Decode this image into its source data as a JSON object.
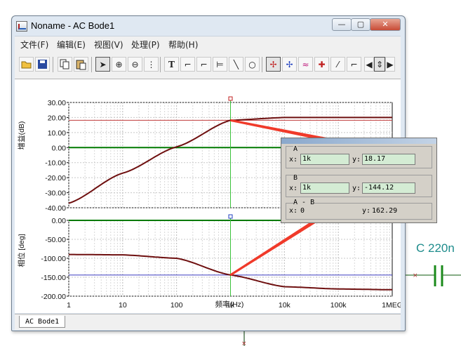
{
  "window": {
    "title": "Noname - AC Bode1",
    "controls": {
      "minimize": "—",
      "maximize": "▢",
      "close": "✕"
    }
  },
  "menu": [
    "文件(F)",
    "编辑(E)",
    "视图(V)",
    "处理(P)",
    "帮助(H)"
  ],
  "toolbar": [
    "open-folder-icon",
    "save-icon",
    "copy-icon",
    "paste-icon",
    "select-arrow-icon",
    "zoom-in-icon",
    "zoom-100-icon",
    "grid-icon",
    "text-tool-icon",
    "label-tool-icon",
    "label-tool-2-icon",
    "axis-tool-icon",
    "line-tool-icon",
    "ellipse-tool-icon",
    "cursor-a-icon",
    "cursor-b-icon",
    "trace-icon",
    "marker-icon",
    "angle-icon",
    "scroll-left-icon",
    "scroll-updown-icon",
    "scroll-right-icon"
  ],
  "gain_plot": {
    "ylabel": "增益(dB)",
    "yticks": [
      "30.00",
      "20.00",
      "10.00",
      "0.00",
      "-10.00",
      "-20.00",
      "-30.00",
      "-40.00"
    ]
  },
  "phase_plot": {
    "ylabel": "相位 [deg]",
    "yticks": [
      "0.00",
      "-50.00",
      "-100.00",
      "-150.00",
      "-200.00"
    ]
  },
  "x_axis": {
    "xlabel": "频率(Hz)",
    "xticks": [
      "1",
      "10",
      "100",
      "1k",
      "10k",
      "100k",
      "1MEG"
    ]
  },
  "chart_data": [
    {
      "type": "line",
      "ylabel": "增益(dB)",
      "x_scale": "log",
      "xlim": [
        1,
        1000000
      ],
      "ylim": [
        -40,
        30
      ],
      "grid": true,
      "x": [
        1,
        10,
        100,
        1000,
        10000,
        100000,
        1000000
      ],
      "values": [
        -37,
        -17,
        0.5,
        18.17,
        20,
        20,
        20
      ]
    },
    {
      "type": "line",
      "ylabel": "相位 [deg]",
      "x_scale": "log",
      "xlim": [
        1,
        1000000
      ],
      "ylim": [
        -200,
        0
      ],
      "grid": true,
      "x": [
        1,
        10,
        100,
        1000,
        10000,
        100000,
        1000000
      ],
      "values": [
        -90,
        -91,
        -100,
        -144.12,
        -175,
        -181,
        -183
      ]
    }
  ],
  "cursor_dialog": {
    "a_label": "A",
    "a_x": "1k",
    "a_y": "18.17",
    "b_label": "B",
    "b_x": "1k",
    "b_y": "-144.12",
    "diff_label": "A - B",
    "diff_x": "0",
    "diff_y": "162.29",
    "x_prefix": "x:",
    "y_prefix": "y:"
  },
  "status": {
    "tab": "AC Bode1"
  },
  "schematic": {
    "capacitor_label": "C 220n"
  },
  "colors": {
    "trace": "#6e0f0f",
    "arrow": "#f03a2a",
    "zero_line": "#007a00",
    "cursor": "#39c239"
  }
}
